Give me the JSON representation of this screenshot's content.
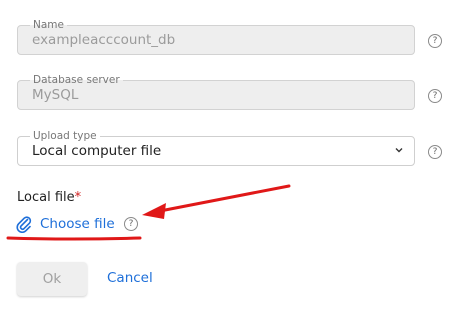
{
  "form": {
    "name": {
      "label": "Name",
      "value": "exampleacccount_db"
    },
    "database_server": {
      "label": "Database server",
      "value": "MySQL"
    },
    "upload_type": {
      "label": "Upload type",
      "selected": "Local computer file"
    },
    "local_file": {
      "label": "Local file",
      "required_mark": "*",
      "choose_label": "Choose file",
      "icon": "paperclip-icon"
    },
    "help_glyph": "?",
    "buttons": {
      "ok": "Ok",
      "cancel": "Cancel"
    }
  },
  "annotation": {
    "color": "#e01818"
  },
  "colors": {
    "link": "#1e6fd9",
    "required": "#d02020"
  }
}
